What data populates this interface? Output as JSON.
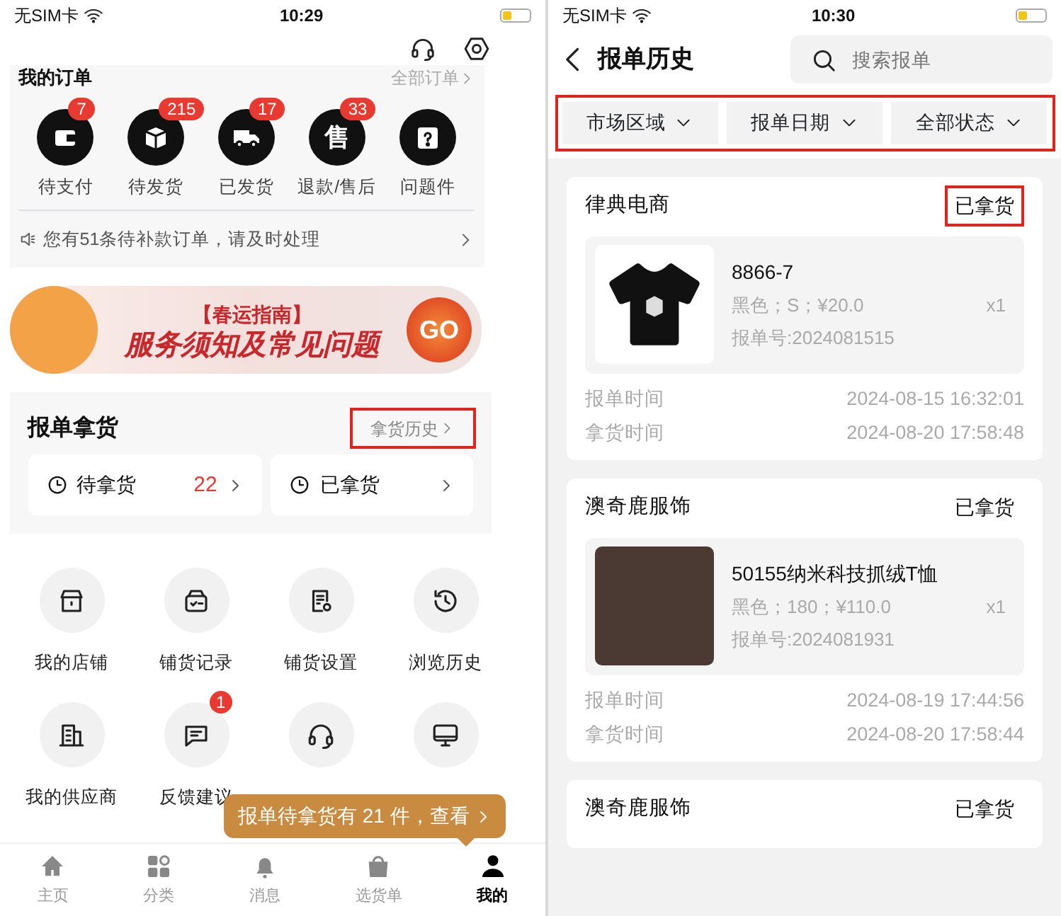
{
  "left_screen": {
    "status_bar": {
      "carrier": "无SIM卡",
      "time": "10:29"
    },
    "my_orders": {
      "title": "我的订单",
      "all_link": "全部订单",
      "statuses": [
        {
          "kind": "wallet",
          "label": "待支付",
          "badge": "7"
        },
        {
          "kind": "box",
          "label": "待发货",
          "badge": "215"
        },
        {
          "kind": "truck",
          "label": "已发货",
          "badge": "17"
        },
        {
          "kind": "glyph",
          "glyph": "售",
          "label": "退款/售后",
          "badge": "33"
        },
        {
          "kind": "question",
          "label": "问题件"
        }
      ],
      "notice": "您有51条待补款订单，请及时处理"
    },
    "banner": {
      "tag": "【春运指南】",
      "headline": "服务须知及常见问题",
      "button": "GO"
    },
    "pickup": {
      "title": "报单拿货",
      "history_link": "拿货历史",
      "highlighted": true,
      "cards": [
        {
          "label": "待拿货",
          "count": "22"
        },
        {
          "label": "已拿货"
        }
      ]
    },
    "tools": [
      {
        "kind": "store",
        "label": "我的店铺"
      },
      {
        "kind": "record",
        "label": "铺货记录"
      },
      {
        "kind": "doc-gear",
        "label": "铺货设置"
      },
      {
        "kind": "history",
        "label": "浏览历史"
      },
      {
        "kind": "building",
        "label": "我的供应商"
      },
      {
        "kind": "chat",
        "label": "反馈建议",
        "badge": "1"
      },
      {
        "kind": "headset"
      },
      {
        "kind": "monitor"
      }
    ],
    "tooltip": "报单待拿货有 21 件，查看",
    "tabs": [
      {
        "kind": "home",
        "label": "主页",
        "selected": false
      },
      {
        "kind": "grid",
        "label": "分类",
        "selected": false
      },
      {
        "kind": "bell",
        "label": "消息",
        "selected": false
      },
      {
        "kind": "bag",
        "label": "选货单",
        "selected": false
      },
      {
        "kind": "person",
        "label": "我的",
        "selected": true
      }
    ]
  },
  "right_screen": {
    "status_bar": {
      "carrier": "无SIM卡",
      "time": "10:30"
    },
    "title": "报单历史",
    "search": {
      "placeholder": "搜索报单"
    },
    "filters_highlighted": true,
    "filters": [
      "市场区域",
      "报单日期",
      "全部状态"
    ],
    "orders": [
      {
        "shop": "律典电商",
        "status": "已拿货",
        "status_highlighted": true,
        "product": {
          "kind": "tshirt",
          "name": "8866-7",
          "spec": "黑色；S；¥20.0",
          "qty": "x1",
          "order_no": "报单号:2024081515"
        },
        "times": [
          {
            "label": "报单时间",
            "value": "2024-08-15 16:32:01"
          },
          {
            "label": "拿货时间",
            "value": "2024-08-20 17:58:48"
          }
        ]
      },
      {
        "shop": "澳奇鹿服饰",
        "status": "已拿货",
        "status_highlighted": false,
        "product": {
          "kind": "photo",
          "name": "50155纳米科技抓绒T恤",
          "spec": "黑色；180；¥110.0",
          "qty": "x1",
          "order_no": "报单号:2024081931"
        },
        "times": [
          {
            "label": "报单时间",
            "value": "2024-08-19 17:44:56"
          },
          {
            "label": "拿货时间",
            "value": "2024-08-20 17:58:44"
          }
        ]
      },
      {
        "shop": "澳奇鹿服饰",
        "status": "已拿货",
        "status_highlighted": false
      }
    ]
  }
}
